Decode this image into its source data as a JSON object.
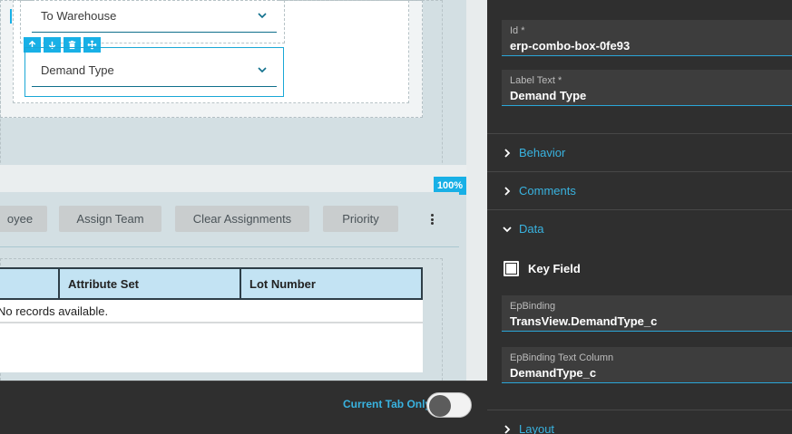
{
  "canvas": {
    "combo_to_warehouse": {
      "label": "To Warehouse"
    },
    "combo_demand_type": {
      "label": "Demand Type"
    },
    "zoom_badge": "100%",
    "toolbar": {
      "buttons": [
        "oyee",
        "Assign Team",
        "Clear Assignments",
        "Priority"
      ]
    },
    "grid": {
      "columns": [
        "",
        "Attribute Set",
        "Lot Number"
      ],
      "empty_text": "No records available."
    }
  },
  "bottom_bar": {
    "current_tab_label": "Current Tab Only",
    "current_tab_only": false
  },
  "properties": {
    "id_field": {
      "label": "Id *",
      "value": "erp-combo-box-0fe93"
    },
    "label_text_field": {
      "label": "Label Text *",
      "value": "Demand Type"
    },
    "sections": {
      "behavior": "Behavior",
      "comments": "Comments",
      "data": "Data",
      "layout": "Layout"
    },
    "key_field": {
      "label": "Key Field",
      "checked": false
    },
    "ep_binding": {
      "label": "EpBinding",
      "value": "TransView.DemandType_c"
    },
    "ep_binding_text": {
      "label": "EpBinding Text Column",
      "value": "DemandType_c"
    }
  },
  "colors": {
    "accent": "#18b0e6",
    "panel_bg": "#2f2f2f",
    "field_bg": "#3d3d3d",
    "link": "#39b3e0",
    "canvas_bg": "#d3dfe3",
    "grid_header": "#c3e3f3"
  }
}
